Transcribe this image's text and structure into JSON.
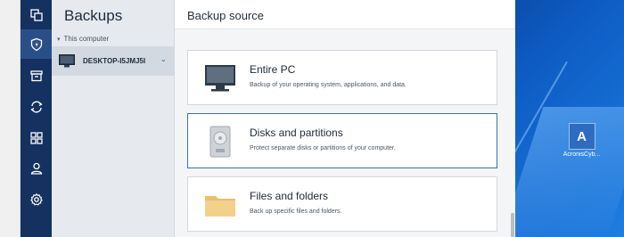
{
  "desktop": {
    "icon_glyph": "A",
    "icon_label": "AcronisCyb..."
  },
  "nav": {
    "items": [
      {
        "icon": "copy-icon"
      },
      {
        "icon": "shield-icon",
        "active": true
      },
      {
        "icon": "archive-icon"
      },
      {
        "icon": "sync-icon"
      },
      {
        "icon": "grid-icon"
      },
      {
        "icon": "account-icon"
      },
      {
        "icon": "gear-icon"
      }
    ]
  },
  "panel": {
    "title": "Backups",
    "group_label": "This computer",
    "device_name": "DESKTOP-I5JMJ5I"
  },
  "main": {
    "title": "Backup source",
    "options": [
      {
        "title": "Entire PC",
        "description": "Backup of your operating system, applications, and data.",
        "icon": "monitor-icon"
      },
      {
        "title": "Disks and partitions",
        "description": "Protect separate disks or partitions of your computer.",
        "icon": "disk-icon",
        "selected": true
      },
      {
        "title": "Files and folders",
        "description": "Back up specific files and folders.",
        "icon": "folder-icon"
      }
    ]
  },
  "colors": {
    "nav_bg": "#14315f",
    "nav_active": "#2a4f88",
    "selected_border": "#3d6fb0"
  }
}
